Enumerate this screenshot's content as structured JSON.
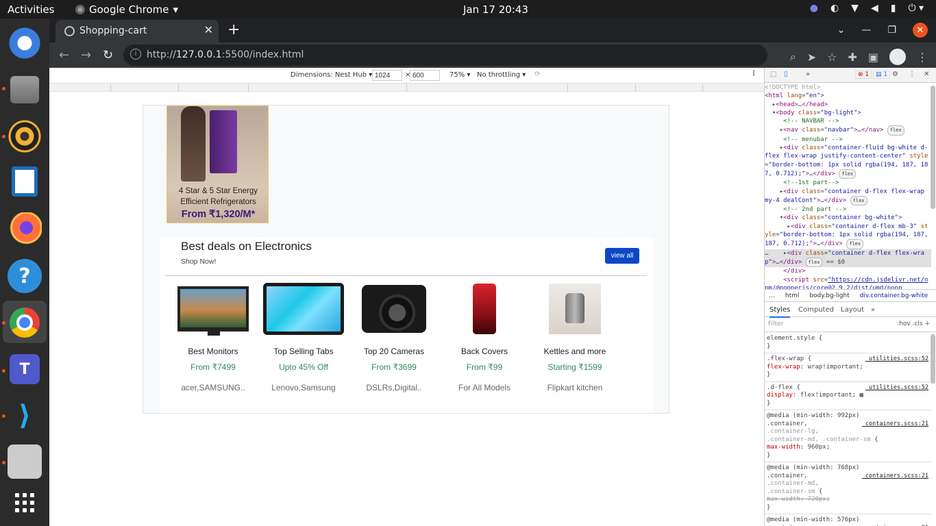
{
  "topbar": {
    "activities": "Activities",
    "app": "Google Chrome",
    "clock": "Jan 17  20:43"
  },
  "browser": {
    "tab_title": "Shopping-cart",
    "url_prefix": "http://",
    "url_host": "127.0.0.1",
    "url_rest": ":5500/index.html"
  },
  "device_toolbar": {
    "dimensions": "Dimensions: Nest Hub ▾",
    "width": "1024",
    "height": "600",
    "x": "×",
    "zoom": "75% ▾",
    "throttle": "No throttling ▾"
  },
  "promo": {
    "line1": "4 Star & 5 Star Energy",
    "line2": "Efficient Refrigerators",
    "price": "From ₹1,320/M*"
  },
  "deals": {
    "title": "Best deals on Electronics",
    "subtitle": "Shop Now!",
    "view_all": "view all",
    "items": [
      {
        "name": "Best Monitors",
        "price": "From ₹7499",
        "brand": "acer,SAMSUNG.."
      },
      {
        "name": "Top Selling Tabs",
        "price": "Upto 45% Off",
        "brand": "Lenovo,Samsung"
      },
      {
        "name": "Top 20 Cameras",
        "price": "From ₹3699",
        "brand": "DSLRs,Digital.."
      },
      {
        "name": "Back Covers",
        "price": "From ₹99",
        "brand": "For All Models"
      },
      {
        "name": "Kettles and more",
        "price": "Starting ₹1599",
        "brand": "Flipkart kitchen"
      }
    ]
  },
  "devtools": {
    "errors": "1",
    "messages": "1",
    "breadcrumbs": [
      "html",
      "body.bg-light",
      "div.container.bg-white"
    ],
    "style_tabs": [
      "Styles",
      "Computed",
      "Layout"
    ],
    "filter_placeholder": "Filter",
    "filter_tools": ":hov  .cls  +"
  },
  "colors": {
    "accent": "#0d47c7",
    "price_green": "#2e8b57",
    "ubuntu_orange": "#e95420"
  }
}
